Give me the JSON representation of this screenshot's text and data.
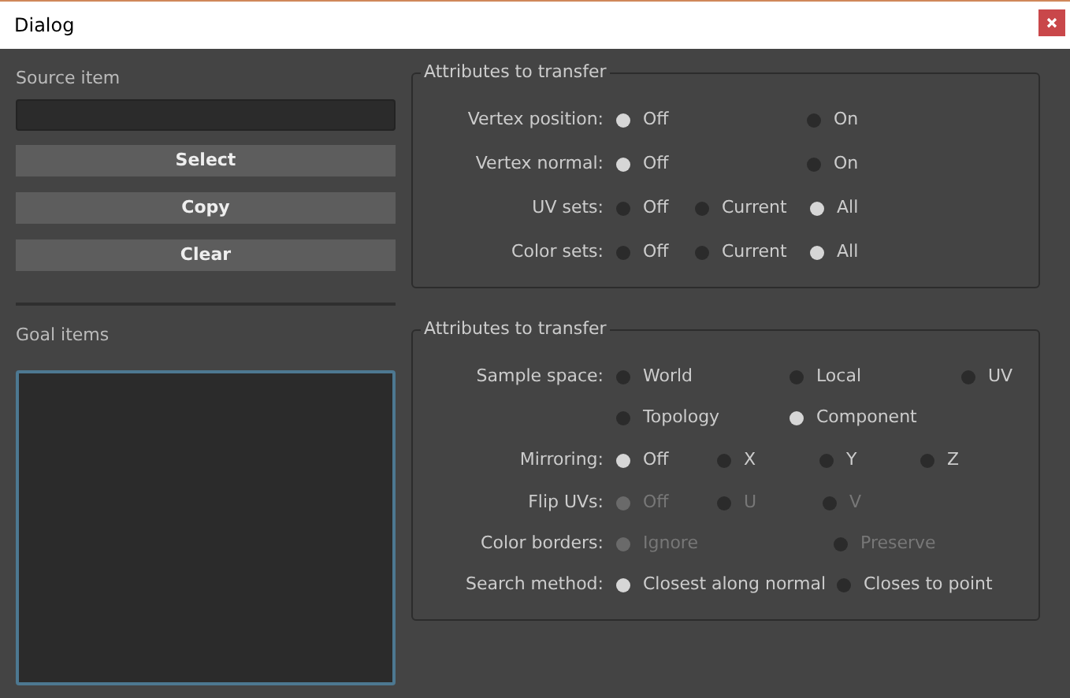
{
  "window": {
    "title": "Dialog"
  },
  "source": {
    "label": "Source item",
    "buttons": [
      "Select",
      "Copy",
      "Clear"
    ]
  },
  "goal": {
    "label": "Goal items"
  },
  "groups": [
    {
      "title": "Attributes to transfer",
      "rows": [
        {
          "label": "Vertex position:",
          "disabled": false,
          "options": [
            {
              "label": "Off",
              "selected": true
            },
            {
              "label": "On",
              "selected": false
            }
          ]
        },
        {
          "label": "Vertex normal:",
          "disabled": false,
          "options": [
            {
              "label": "Off",
              "selected": true
            },
            {
              "label": "On",
              "selected": false
            }
          ]
        },
        {
          "label": "UV sets:",
          "disabled": false,
          "options": [
            {
              "label": "Off",
              "selected": false
            },
            {
              "label": "Current",
              "selected": false
            },
            {
              "label": "All",
              "selected": true
            }
          ]
        },
        {
          "label": "Color sets:",
          "disabled": false,
          "options": [
            {
              "label": "Off",
              "selected": false
            },
            {
              "label": "Current",
              "selected": false
            },
            {
              "label": "All",
              "selected": true
            }
          ]
        }
      ]
    },
    {
      "title": "Attributes to transfer",
      "rows": [
        {
          "label": "Sample space:",
          "disabled": false,
          "options": [
            {
              "label": "World",
              "selected": false
            },
            {
              "label": "Local",
              "selected": false
            },
            {
              "label": "UV",
              "selected": false
            },
            {
              "label": "Topology",
              "selected": false
            },
            {
              "label": "Component",
              "selected": true
            }
          ]
        },
        {
          "label": "Mirroring:",
          "disabled": false,
          "options": [
            {
              "label": "Off",
              "selected": true
            },
            {
              "label": "X",
              "selected": false
            },
            {
              "label": "Y",
              "selected": false
            },
            {
              "label": "Z",
              "selected": false
            }
          ]
        },
        {
          "label": "Flip UVs:",
          "disabled": true,
          "options": [
            {
              "label": "Off",
              "selected": true
            },
            {
              "label": "U",
              "selected": false
            },
            {
              "label": "V",
              "selected": false
            }
          ]
        },
        {
          "label": "Color borders:",
          "disabled": true,
          "options": [
            {
              "label": "Ignore",
              "selected": true
            },
            {
              "label": "Preserve",
              "selected": false
            }
          ]
        },
        {
          "label": "Search method:",
          "disabled": false,
          "options": [
            {
              "label": "Closest along normal",
              "selected": true
            },
            {
              "label": "Closes to point",
              "selected": false
            }
          ]
        }
      ]
    }
  ]
}
